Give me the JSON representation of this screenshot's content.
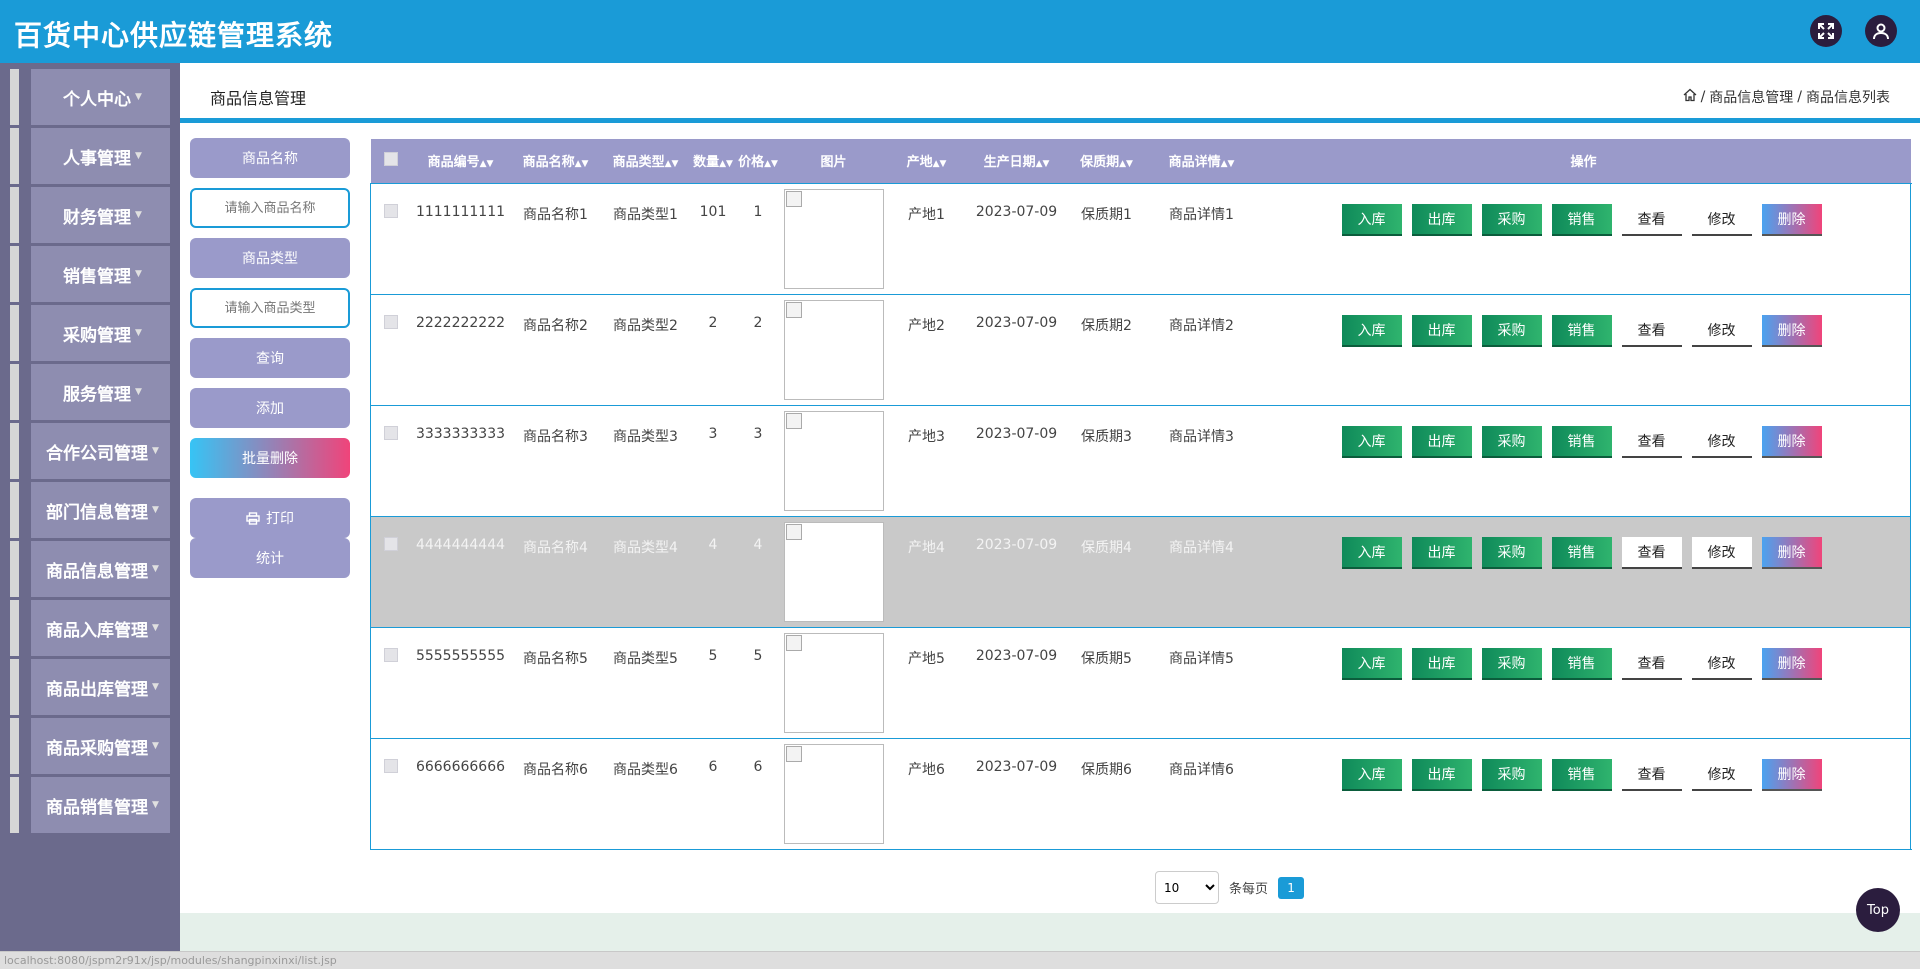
{
  "header": {
    "title": "百货中心供应链管理系统",
    "fullscreen_icon": "fullscreen-icon",
    "user_icon": "user-icon"
  },
  "sidebar": {
    "items": [
      {
        "label": "个人中心"
      },
      {
        "label": "人事管理"
      },
      {
        "label": "财务管理"
      },
      {
        "label": "销售管理"
      },
      {
        "label": "采购管理"
      },
      {
        "label": "服务管理"
      },
      {
        "label": "合作公司管理"
      },
      {
        "label": "部门信息管理"
      },
      {
        "label": "商品信息管理"
      },
      {
        "label": "商品入库管理"
      },
      {
        "label": "商品出库管理"
      },
      {
        "label": "商品采购管理"
      },
      {
        "label": "商品销售管理"
      }
    ]
  },
  "page": {
    "title": "商品信息管理",
    "breadcrumb": [
      "商品信息管理",
      "商品信息列表"
    ],
    "breadcrumb_sep": "/"
  },
  "search": {
    "name_label": "商品名称",
    "name_placeholder": "请输入商品名称",
    "type_label": "商品类型",
    "type_placeholder": "请输入商品类型",
    "query": "查询",
    "add": "添加",
    "batch_delete": "批量删除",
    "print": "打印",
    "stats": "统计"
  },
  "table": {
    "columns": [
      "商品编号",
      "商品名称",
      "商品类型",
      "数量",
      "价格",
      "图片",
      "产地",
      "生产日期",
      "保质期",
      "商品详情",
      "操作"
    ],
    "rows": [
      {
        "code": "1111111111",
        "name": "商品名称1",
        "type": "商品类型1",
        "qty": "101",
        "price": "1",
        "origin": "产地1",
        "date": "2023-07-09",
        "shelf": "保质期1",
        "detail": "商品详情1"
      },
      {
        "code": "2222222222",
        "name": "商品名称2",
        "type": "商品类型2",
        "qty": "2",
        "price": "2",
        "origin": "产地2",
        "date": "2023-07-09",
        "shelf": "保质期2",
        "detail": "商品详情2"
      },
      {
        "code": "3333333333",
        "name": "商品名称3",
        "type": "商品类型3",
        "qty": "3",
        "price": "3",
        "origin": "产地3",
        "date": "2023-07-09",
        "shelf": "保质期3",
        "detail": "商品详情3"
      },
      {
        "code": "4444444444",
        "name": "商品名称4",
        "type": "商品类型4",
        "qty": "4",
        "price": "4",
        "origin": "产地4",
        "date": "2023-07-09",
        "shelf": "保质期4",
        "detail": "商品详情4"
      },
      {
        "code": "5555555555",
        "name": "商品名称5",
        "type": "商品类型5",
        "qty": "5",
        "price": "5",
        "origin": "产地5",
        "date": "2023-07-09",
        "shelf": "保质期5",
        "detail": "商品详情5"
      },
      {
        "code": "6666666666",
        "name": "商品名称6",
        "type": "商品类型6",
        "qty": "6",
        "price": "6",
        "origin": "产地6",
        "date": "2023-07-09",
        "shelf": "保质期6",
        "detail": "商品详情6"
      }
    ],
    "actions": [
      "入库",
      "出库",
      "采购",
      "销售",
      "查看",
      "修改",
      "删除"
    ]
  },
  "pagination": {
    "page_size": "10",
    "per_page_label": "条每页",
    "current_page": "1"
  },
  "top_button": "Top",
  "status_url": "localhost:8080/jspm2r91x/jsp/modules/shangpinxinxi/list.jsp"
}
